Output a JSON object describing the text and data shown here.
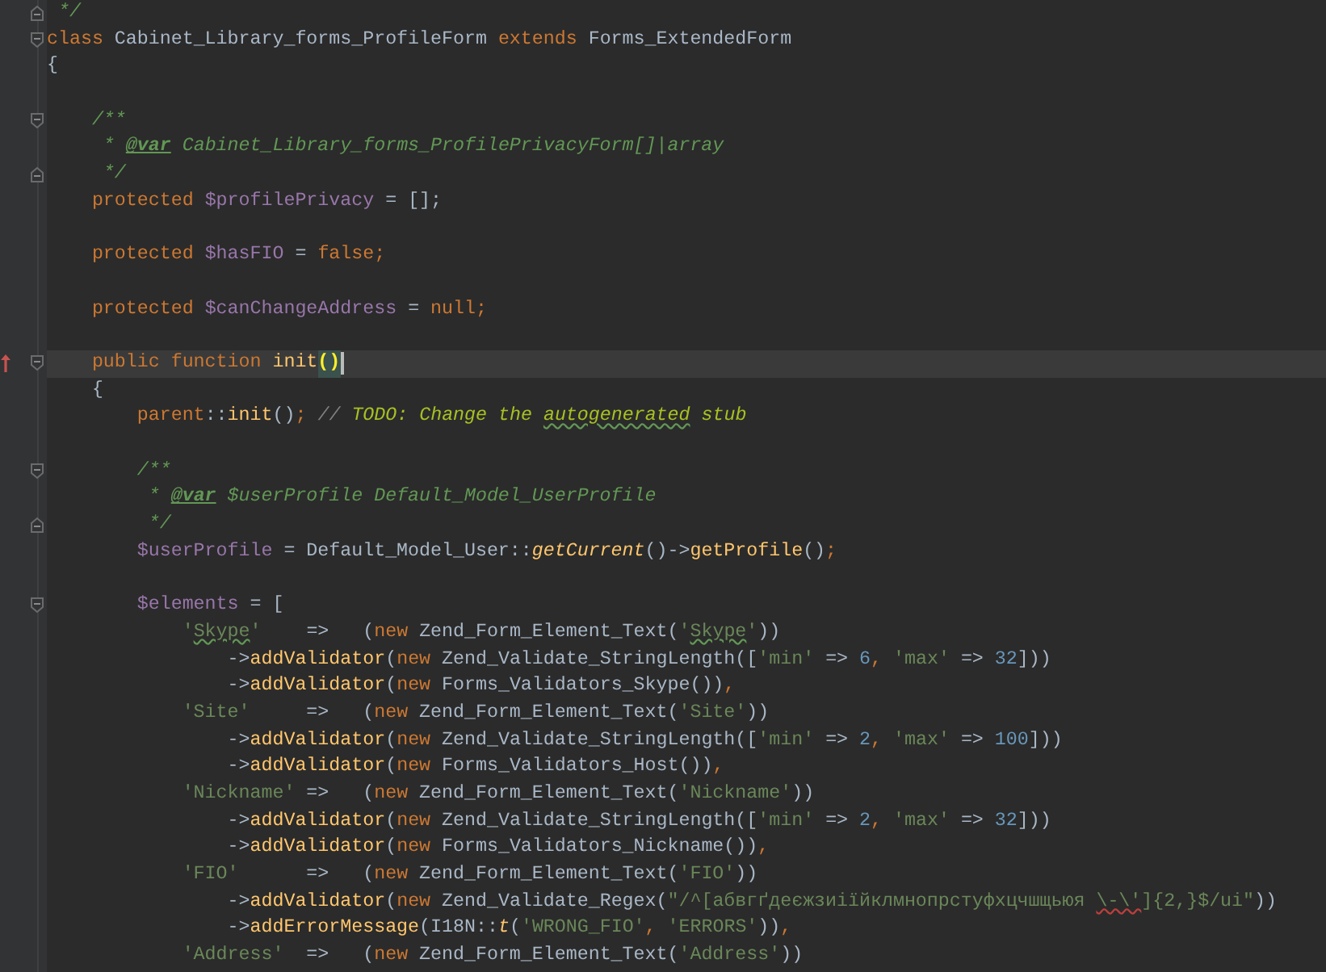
{
  "editor": {
    "lines": [
      {
        "current": false,
        "fold": {
          "kind": "end"
        },
        "tokens": [
          {
            "kind": "doc",
            "text": " */"
          }
        ]
      },
      {
        "current": false,
        "fold": {
          "kind": "start"
        },
        "tokens": [
          {
            "kind": "keyword",
            "text": "class"
          },
          {
            "kind": "plain",
            "text": " Cabinet_Library_forms_ProfileForm "
          },
          {
            "kind": "keyword",
            "text": "extends"
          },
          {
            "kind": "plain",
            "text": " Forms_ExtendedForm"
          }
        ]
      },
      {
        "current": false,
        "tokens": [
          {
            "kind": "plain",
            "text": "{"
          }
        ]
      },
      {
        "current": false
      },
      {
        "current": false,
        "fold": {
          "kind": "start"
        },
        "tokens": [
          {
            "kind": "doc",
            "text": "    /**"
          }
        ]
      },
      {
        "current": false,
        "tokens": [
          {
            "kind": "doc",
            "text": "     * "
          },
          {
            "kind": "doctag",
            "text": "@var"
          },
          {
            "kind": "doc",
            "text": " Cabinet_Library_forms_ProfilePrivacyForm[]|array"
          }
        ]
      },
      {
        "current": false,
        "fold": {
          "kind": "end"
        },
        "tokens": [
          {
            "kind": "doc",
            "text": "     */"
          }
        ]
      },
      {
        "current": false,
        "tokens": [
          {
            "kind": "keyword",
            "text": "    protected "
          },
          {
            "kind": "var",
            "text": "$profilePrivacy"
          },
          {
            "kind": "plain",
            "text": " = [];"
          }
        ]
      },
      {
        "current": false
      },
      {
        "current": false,
        "tokens": [
          {
            "kind": "keyword",
            "text": "    protected "
          },
          {
            "kind": "var",
            "text": "$hasFIO"
          },
          {
            "kind": "plain",
            "text": " = "
          },
          {
            "kind": "keyword",
            "text": "false;"
          }
        ]
      },
      {
        "current": false
      },
      {
        "current": false,
        "tokens": [
          {
            "kind": "keyword",
            "text": "    protected "
          },
          {
            "kind": "var",
            "text": "$canChangeAddress"
          },
          {
            "kind": "plain",
            "text": " = "
          },
          {
            "kind": "keyword",
            "text": "null;"
          }
        ]
      },
      {
        "current": false
      },
      {
        "current": true,
        "fold": {
          "kind": "start"
        },
        "marker": {
          "kind": "override"
        },
        "tokens": [
          {
            "kind": "keyword",
            "text": "    public function "
          },
          {
            "kind": "call",
            "text": "init"
          },
          {
            "kind": "match",
            "text": "()",
            "caret": true
          }
        ]
      },
      {
        "current": false,
        "tokens": [
          {
            "kind": "plain",
            "text": "    {"
          }
        ]
      },
      {
        "current": false,
        "tokens": [
          {
            "kind": "keyword",
            "text": "        parent"
          },
          {
            "kind": "plain",
            "text": "::"
          },
          {
            "kind": "call",
            "text": "init"
          },
          {
            "kind": "plain",
            "text": "()"
          },
          {
            "kind": "keyword",
            "text": "; "
          },
          {
            "kind": "comment",
            "text": "// "
          },
          {
            "kind": "todo",
            "text": "TODO: Change the "
          },
          {
            "kind": "todo",
            "text": "autogenerated",
            "spelling_error": true
          },
          {
            "kind": "todo",
            "text": " stub"
          }
        ]
      },
      {
        "current": false
      },
      {
        "current": false,
        "fold": {
          "kind": "start"
        },
        "tokens": [
          {
            "kind": "doc",
            "text": "        /**"
          }
        ]
      },
      {
        "current": false,
        "tokens": [
          {
            "kind": "doc",
            "text": "         * "
          },
          {
            "kind": "doctag",
            "text": "@var"
          },
          {
            "kind": "doc",
            "text": " $userProfile Default_Model_UserProfile"
          }
        ]
      },
      {
        "current": false,
        "fold": {
          "kind": "end"
        },
        "tokens": [
          {
            "kind": "doc",
            "text": "         */"
          }
        ]
      },
      {
        "current": false,
        "tokens": [
          {
            "kind": "var",
            "text": "        $userProfile"
          },
          {
            "kind": "plain",
            "text": " = Default_Model_User::"
          },
          {
            "kind": "static",
            "text": "getCurrent"
          },
          {
            "kind": "plain",
            "text": "()->"
          },
          {
            "kind": "call",
            "text": "getProfile"
          },
          {
            "kind": "plain",
            "text": "()"
          },
          {
            "kind": "keyword",
            "text": ";"
          }
        ]
      },
      {
        "current": false
      },
      {
        "current": false,
        "fold": {
          "kind": "start"
        },
        "tokens": [
          {
            "kind": "var",
            "text": "        $elements"
          },
          {
            "kind": "plain",
            "text": " = ["
          }
        ]
      },
      {
        "current": false,
        "tokens": [
          {
            "kind": "string",
            "text": "            '"
          },
          {
            "kind": "string",
            "text": "Skype",
            "spelling_error": true
          },
          {
            "kind": "string",
            "text": "'"
          },
          {
            "kind": "plain",
            "text": "    =>   ("
          },
          {
            "kind": "keyword",
            "text": "new"
          },
          {
            "kind": "plain",
            "text": " Zend_Form_Element_Text("
          },
          {
            "kind": "string",
            "text": "'"
          },
          {
            "kind": "string",
            "text": "Skype",
            "spelling_error": true
          },
          {
            "kind": "string",
            "text": "'"
          },
          {
            "kind": "plain",
            "text": "))"
          }
        ]
      },
      {
        "current": false,
        "tokens": [
          {
            "kind": "plain",
            "text": "                ->"
          },
          {
            "kind": "call",
            "text": "addValidator"
          },
          {
            "kind": "plain",
            "text": "("
          },
          {
            "kind": "keyword",
            "text": "new"
          },
          {
            "kind": "plain",
            "text": " Zend_Validate_StringLength(["
          },
          {
            "kind": "string",
            "text": "'min'"
          },
          {
            "kind": "plain",
            "text": " => "
          },
          {
            "kind": "number",
            "text": "6"
          },
          {
            "kind": "keyword",
            "text": ", "
          },
          {
            "kind": "string",
            "text": "'max'"
          },
          {
            "kind": "plain",
            "text": " => "
          },
          {
            "kind": "number",
            "text": "32"
          },
          {
            "kind": "plain",
            "text": "]))"
          }
        ]
      },
      {
        "current": false,
        "tokens": [
          {
            "kind": "plain",
            "text": "                ->"
          },
          {
            "kind": "call",
            "text": "addValidator"
          },
          {
            "kind": "plain",
            "text": "("
          },
          {
            "kind": "keyword",
            "text": "new"
          },
          {
            "kind": "plain",
            "text": " Forms_Validators_Skype())"
          },
          {
            "kind": "keyword",
            "text": ","
          }
        ]
      },
      {
        "current": false,
        "tokens": [
          {
            "kind": "string",
            "text": "            'Site'"
          },
          {
            "kind": "plain",
            "text": "     =>   ("
          },
          {
            "kind": "keyword",
            "text": "new"
          },
          {
            "kind": "plain",
            "text": " Zend_Form_Element_Text("
          },
          {
            "kind": "string",
            "text": "'Site'"
          },
          {
            "kind": "plain",
            "text": "))"
          }
        ]
      },
      {
        "current": false,
        "tokens": [
          {
            "kind": "plain",
            "text": "                ->"
          },
          {
            "kind": "call",
            "text": "addValidator"
          },
          {
            "kind": "plain",
            "text": "("
          },
          {
            "kind": "keyword",
            "text": "new"
          },
          {
            "kind": "plain",
            "text": " Zend_Validate_StringLength(["
          },
          {
            "kind": "string",
            "text": "'min'"
          },
          {
            "kind": "plain",
            "text": " => "
          },
          {
            "kind": "number",
            "text": "2"
          },
          {
            "kind": "keyword",
            "text": ", "
          },
          {
            "kind": "string",
            "text": "'max'"
          },
          {
            "kind": "plain",
            "text": " => "
          },
          {
            "kind": "number",
            "text": "100"
          },
          {
            "kind": "plain",
            "text": "]))"
          }
        ]
      },
      {
        "current": false,
        "tokens": [
          {
            "kind": "plain",
            "text": "                ->"
          },
          {
            "kind": "call",
            "text": "addValidator"
          },
          {
            "kind": "plain",
            "text": "("
          },
          {
            "kind": "keyword",
            "text": "new"
          },
          {
            "kind": "plain",
            "text": " Forms_Validators_Host())"
          },
          {
            "kind": "keyword",
            "text": ","
          }
        ]
      },
      {
        "current": false,
        "tokens": [
          {
            "kind": "string",
            "text": "            'Nickname'"
          },
          {
            "kind": "plain",
            "text": " =>   ("
          },
          {
            "kind": "keyword",
            "text": "new"
          },
          {
            "kind": "plain",
            "text": " Zend_Form_Element_Text("
          },
          {
            "kind": "string",
            "text": "'Nickname'"
          },
          {
            "kind": "plain",
            "text": "))"
          }
        ]
      },
      {
        "current": false,
        "tokens": [
          {
            "kind": "plain",
            "text": "                ->"
          },
          {
            "kind": "call",
            "text": "addValidator"
          },
          {
            "kind": "plain",
            "text": "("
          },
          {
            "kind": "keyword",
            "text": "new"
          },
          {
            "kind": "plain",
            "text": " Zend_Validate_StringLength(["
          },
          {
            "kind": "string",
            "text": "'min'"
          },
          {
            "kind": "plain",
            "text": " => "
          },
          {
            "kind": "number",
            "text": "2"
          },
          {
            "kind": "keyword",
            "text": ", "
          },
          {
            "kind": "string",
            "text": "'max'"
          },
          {
            "kind": "plain",
            "text": " => "
          },
          {
            "kind": "number",
            "text": "32"
          },
          {
            "kind": "plain",
            "text": "]))"
          }
        ]
      },
      {
        "current": false,
        "tokens": [
          {
            "kind": "plain",
            "text": "                ->"
          },
          {
            "kind": "call",
            "text": "addValidator"
          },
          {
            "kind": "plain",
            "text": "("
          },
          {
            "kind": "keyword",
            "text": "new"
          },
          {
            "kind": "plain",
            "text": " Forms_Validators_Nickname())"
          },
          {
            "kind": "keyword",
            "text": ","
          }
        ]
      },
      {
        "current": false,
        "tokens": [
          {
            "kind": "string",
            "text": "            'FIO'"
          },
          {
            "kind": "plain",
            "text": "      =>   ("
          },
          {
            "kind": "keyword",
            "text": "new"
          },
          {
            "kind": "plain",
            "text": " Zend_Form_Element_Text("
          },
          {
            "kind": "string",
            "text": "'FIO'"
          },
          {
            "kind": "plain",
            "text": "))"
          }
        ]
      },
      {
        "current": false,
        "tokens": [
          {
            "kind": "plain",
            "text": "                ->"
          },
          {
            "kind": "call",
            "text": "addValidator"
          },
          {
            "kind": "plain",
            "text": "("
          },
          {
            "kind": "keyword",
            "text": "new"
          },
          {
            "kind": "plain",
            "text": " Zend_Validate_Regex("
          },
          {
            "kind": "string",
            "text": "\"/^[абвгґдеєжзиіїйклмнопрстуфхцчшщьюя "
          },
          {
            "kind": "string",
            "text": "\\-\\'",
            "syntax_error": true
          },
          {
            "kind": "string",
            "text": "]{2,}$/ui\""
          },
          {
            "kind": "plain",
            "text": "))"
          }
        ]
      },
      {
        "current": false,
        "tokens": [
          {
            "kind": "plain",
            "text": "                ->"
          },
          {
            "kind": "call",
            "text": "addErrorMessage"
          },
          {
            "kind": "plain",
            "text": "(I18N::"
          },
          {
            "kind": "static",
            "text": "t"
          },
          {
            "kind": "plain",
            "text": "("
          },
          {
            "kind": "string",
            "text": "'WRONG_FIO'"
          },
          {
            "kind": "keyword",
            "text": ", "
          },
          {
            "kind": "string",
            "text": "'ERRORS'"
          },
          {
            "kind": "plain",
            "text": "))"
          },
          {
            "kind": "keyword",
            "text": ","
          }
        ]
      },
      {
        "current": false,
        "tokens": [
          {
            "kind": "string",
            "text": "            'Address'"
          },
          {
            "kind": "plain",
            "text": "  =>   ("
          },
          {
            "kind": "keyword",
            "text": "new"
          },
          {
            "kind": "plain",
            "text": " Zend_Form_Element_Text("
          },
          {
            "kind": "string",
            "text": "'Address'"
          },
          {
            "kind": "plain",
            "text": "))"
          }
        ]
      }
    ]
  }
}
